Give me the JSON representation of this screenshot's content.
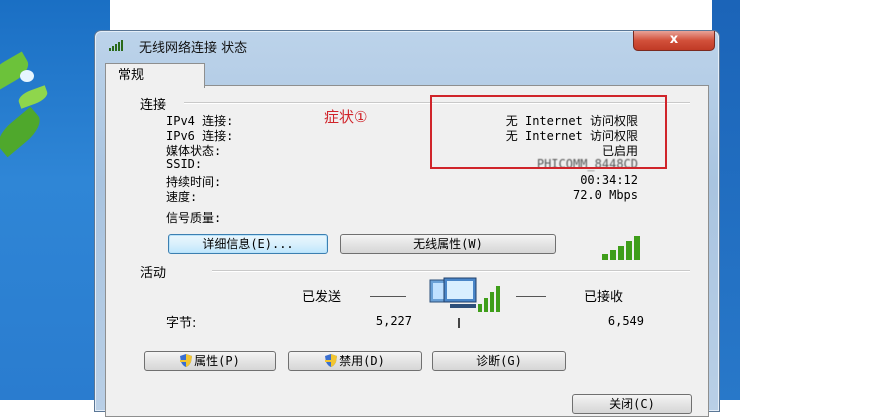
{
  "window": {
    "title": "无线网络连接 状态",
    "close_label": "x"
  },
  "tab": {
    "label": "常规"
  },
  "connection": {
    "heading": "连接",
    "rows": [
      {
        "label": "IPv4 连接:",
        "value": "无 Internet 访问权限"
      },
      {
        "label": "IPv6 连接:",
        "value": "无 Internet 访问权限"
      },
      {
        "label": "媒体状态:",
        "value": "已启用"
      },
      {
        "label": "SSID:",
        "value": "PHICOMM_8448CD"
      },
      {
        "label": "持续时间:",
        "value": "00:34:12"
      },
      {
        "label": "速度:",
        "value": "72.0 Mbps"
      }
    ],
    "signal_label": "信号质量:",
    "signal_bars": 5,
    "details_button": "详细信息(E)...",
    "wireless_props_button": "无线属性(W)"
  },
  "activity": {
    "heading": "活动",
    "sent_label": "已发送",
    "received_label": "已接收",
    "bytes_label": "字节:",
    "bytes_sent": "5,227",
    "bytes_received": "6,549"
  },
  "buttons": {
    "properties": "属性(P)",
    "disable": "禁用(D)",
    "diagnose": "诊断(G)",
    "close": "关闭(C)"
  },
  "annotation": {
    "text": "症状①"
  },
  "colors": {
    "annotation_red": "#d0242a",
    "signal_green": "#3f9e1a"
  }
}
